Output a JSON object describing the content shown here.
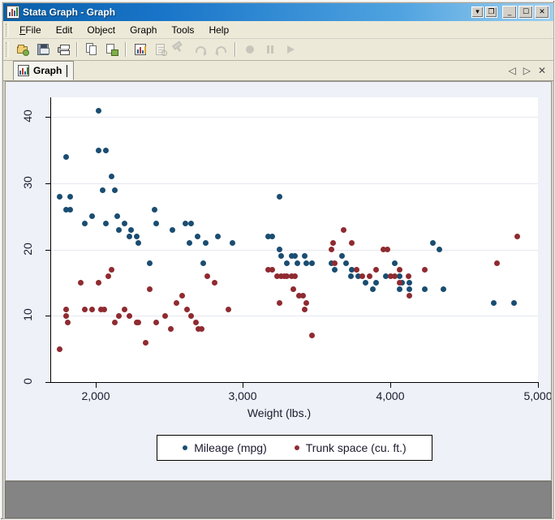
{
  "window": {
    "title": "Stata Graph - Graph",
    "icon": "graph-bar-icon",
    "buttons": [
      {
        "name": "window-menu-dropdown",
        "glyph": "▾"
      },
      {
        "name": "restore-window-button",
        "glyph": "❐"
      },
      {
        "name": "minimize-button",
        "glyph": "_"
      },
      {
        "name": "maximize-button",
        "glyph": "☐"
      },
      {
        "name": "close-button",
        "glyph": "✕"
      }
    ]
  },
  "menubar": {
    "items": [
      {
        "name": "menu-file",
        "label": "File",
        "mnemonic": "F"
      },
      {
        "name": "menu-edit",
        "label": "Edit",
        "mnemonic": "E"
      },
      {
        "name": "menu-object",
        "label": "Object",
        "mnemonic": "O"
      },
      {
        "name": "menu-graph",
        "label": "Graph",
        "mnemonic": "G"
      },
      {
        "name": "menu-tools",
        "label": "Tools",
        "mnemonic": "T"
      },
      {
        "name": "menu-help",
        "label": "Help",
        "mnemonic": "H"
      }
    ]
  },
  "toolbar": {
    "items": [
      {
        "name": "open-icon",
        "enabled": true
      },
      {
        "name": "save-icon",
        "enabled": true
      },
      {
        "name": "print-icon",
        "enabled": true
      },
      {
        "name": "copy-icon",
        "enabled": true
      },
      {
        "name": "paste-graph-icon",
        "enabled": true
      },
      {
        "name": "graph-editor-icon",
        "enabled": true
      },
      {
        "name": "preview-icon",
        "enabled": false
      },
      {
        "name": "pin-icon",
        "enabled": false
      },
      {
        "name": "redo-icon",
        "enabled": false
      },
      {
        "name": "undo-icon",
        "enabled": false
      },
      {
        "name": "record-icon",
        "enabled": false
      },
      {
        "name": "pause-icon",
        "enabled": false
      },
      {
        "name": "play-icon",
        "enabled": false
      }
    ]
  },
  "tabbar": {
    "tabs": [
      {
        "name": "tab-graph",
        "label": "Graph",
        "icon": "graph-bar-icon",
        "active": true
      }
    ],
    "nav": [
      {
        "name": "tab-prev-button",
        "glyph": "◁"
      },
      {
        "name": "tab-next-button",
        "glyph": "▷"
      },
      {
        "name": "tab-close-button",
        "glyph": "✕"
      }
    ]
  },
  "colors": {
    "mpg": "#1a4d71",
    "trunk": "#8f2b30",
    "plot_background": "#ffffff",
    "canvas_background": "#eef1f7",
    "grid": "#e6e8f0",
    "axis": "#000000",
    "title_bar_start": "#0a5fa8",
    "title_bar_end": "#9fd0f0"
  },
  "chart_data": {
    "type": "scatter",
    "title": "",
    "xlabel": "Weight (lbs.)",
    "ylabel": "",
    "xlim": [
      1700,
      5000
    ],
    "ylim": [
      0,
      43
    ],
    "xticks": [
      2000,
      3000,
      4000,
      5000
    ],
    "xticklabels": [
      "2,000",
      "3,000",
      "4,000",
      "5,000"
    ],
    "yticks": [
      0,
      10,
      20,
      30,
      40
    ],
    "yticklabels": [
      "0",
      "10",
      "20",
      "30",
      "40"
    ],
    "grid": "horizontal",
    "legend": {
      "position": "bottom",
      "border": true
    },
    "series": [
      {
        "name": "Mileage (mpg)",
        "label": "Mileage (mpg)",
        "color": "#1a4d71",
        "marker": "circle",
        "points": [
          [
            1760,
            28
          ],
          [
            1800,
            34
          ],
          [
            1830,
            28
          ],
          [
            1800,
            26
          ],
          [
            1830,
            26
          ],
          [
            1930,
            24
          ],
          [
            1980,
            25
          ],
          [
            2020,
            41
          ],
          [
            2020,
            35
          ],
          [
            2070,
            35
          ],
          [
            2050,
            29
          ],
          [
            2110,
            31
          ],
          [
            2130,
            29
          ],
          [
            2070,
            24
          ],
          [
            2150,
            25
          ],
          [
            2160,
            23
          ],
          [
            2200,
            24
          ],
          [
            2230,
            22
          ],
          [
            2240,
            23
          ],
          [
            2280,
            22
          ],
          [
            2290,
            21
          ],
          [
            2370,
            18
          ],
          [
            2400,
            26
          ],
          [
            2410,
            24
          ],
          [
            2520,
            23
          ],
          [
            2610,
            24
          ],
          [
            2650,
            24
          ],
          [
            2640,
            21
          ],
          [
            2690,
            22
          ],
          [
            2730,
            18
          ],
          [
            2750,
            21
          ],
          [
            2830,
            22
          ],
          [
            2930,
            21
          ],
          [
            3170,
            22
          ],
          [
            3250,
            28
          ],
          [
            3200,
            22
          ],
          [
            3250,
            20
          ],
          [
            3260,
            19
          ],
          [
            3300,
            18
          ],
          [
            3330,
            19
          ],
          [
            3350,
            19
          ],
          [
            3370,
            18
          ],
          [
            3420,
            19
          ],
          [
            3430,
            18
          ],
          [
            3470,
            18
          ],
          [
            3600,
            18
          ],
          [
            3620,
            17
          ],
          [
            3670,
            19
          ],
          [
            3700,
            18
          ],
          [
            3730,
            16
          ],
          [
            3740,
            17
          ],
          [
            3780,
            16
          ],
          [
            3830,
            15
          ],
          [
            3880,
            14
          ],
          [
            3900,
            15
          ],
          [
            3970,
            16
          ],
          [
            4030,
            18
          ],
          [
            4060,
            14
          ],
          [
            4080,
            15
          ],
          [
            4130,
            14
          ],
          [
            4060,
            16
          ],
          [
            4130,
            15
          ],
          [
            4230,
            14
          ],
          [
            4290,
            21
          ],
          [
            4330,
            20
          ],
          [
            4360,
            14
          ],
          [
            4700,
            12
          ],
          [
            4840,
            12
          ]
        ]
      },
      {
        "name": "Trunk space (cu. ft.)",
        "label": "Trunk space (cu. ft.)",
        "color": "#8f2b30",
        "marker": "circle",
        "points": [
          [
            1760,
            5
          ],
          [
            1800,
            11
          ],
          [
            1800,
            10
          ],
          [
            1810,
            9
          ],
          [
            1900,
            15
          ],
          [
            1930,
            11
          ],
          [
            1980,
            11
          ],
          [
            2020,
            15
          ],
          [
            2040,
            11
          ],
          [
            2060,
            11
          ],
          [
            2090,
            16
          ],
          [
            2110,
            17
          ],
          [
            2130,
            9
          ],
          [
            2160,
            10
          ],
          [
            2200,
            11
          ],
          [
            2230,
            10
          ],
          [
            2280,
            9
          ],
          [
            2290,
            9
          ],
          [
            2340,
            6
          ],
          [
            2370,
            14
          ],
          [
            2410,
            9
          ],
          [
            2470,
            10
          ],
          [
            2510,
            8
          ],
          [
            2550,
            12
          ],
          [
            2590,
            13
          ],
          [
            2620,
            11
          ],
          [
            2650,
            10
          ],
          [
            2680,
            9
          ],
          [
            2700,
            8
          ],
          [
            2720,
            8
          ],
          [
            2760,
            16
          ],
          [
            2810,
            15
          ],
          [
            2900,
            11
          ],
          [
            3170,
            17
          ],
          [
            3200,
            17
          ],
          [
            3230,
            16
          ],
          [
            3260,
            16
          ],
          [
            3280,
            16
          ],
          [
            3300,
            16
          ],
          [
            3330,
            16
          ],
          [
            3350,
            16
          ],
          [
            3250,
            12
          ],
          [
            3340,
            14
          ],
          [
            3380,
            13
          ],
          [
            3410,
            13
          ],
          [
            3420,
            11
          ],
          [
            3470,
            7
          ],
          [
            3430,
            12
          ],
          [
            3600,
            20
          ],
          [
            3610,
            21
          ],
          [
            3620,
            18
          ],
          [
            3680,
            23
          ],
          [
            3740,
            21
          ],
          [
            3770,
            17
          ],
          [
            3810,
            16
          ],
          [
            3860,
            16
          ],
          [
            3900,
            17
          ],
          [
            3950,
            20
          ],
          [
            3980,
            20
          ],
          [
            4000,
            16
          ],
          [
            4030,
            16
          ],
          [
            4060,
            17
          ],
          [
            4120,
            16
          ],
          [
            4060,
            15
          ],
          [
            4130,
            13
          ],
          [
            4230,
            17
          ],
          [
            4720,
            18
          ],
          [
            4860,
            22
          ]
        ]
      }
    ]
  }
}
